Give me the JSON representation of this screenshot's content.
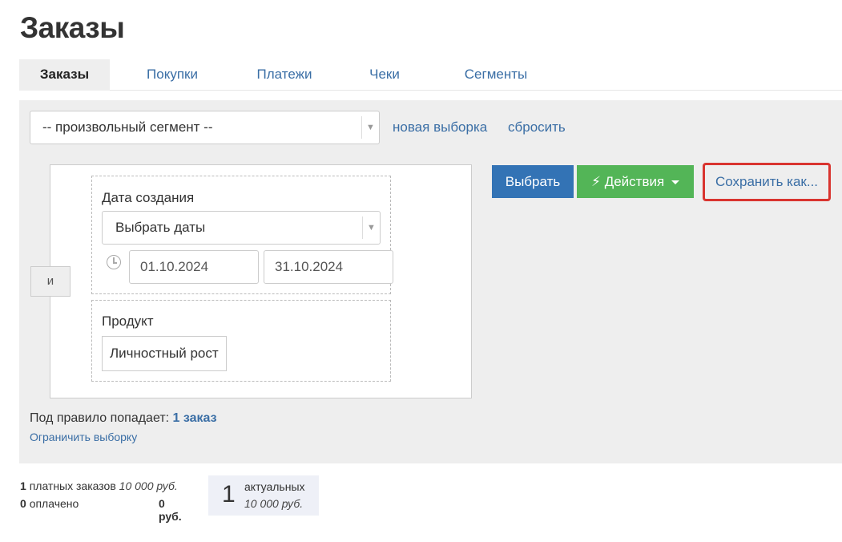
{
  "page": {
    "title": "Заказы"
  },
  "tabs": [
    {
      "label": "Заказы",
      "active": true
    },
    {
      "label": "Покупки",
      "active": false
    },
    {
      "label": "Платежи",
      "active": false
    },
    {
      "label": "Чеки",
      "active": false
    },
    {
      "label": "Сегменты",
      "active": false
    }
  ],
  "filter": {
    "segment_select": {
      "value": "-- произвольный сегмент --"
    },
    "new_selection_label": "новая выборка",
    "reset_label": "сбросить",
    "logic_operator": "и",
    "conditions": {
      "created_date": {
        "label": "Дата создания",
        "select_value": "Выбрать даты",
        "date_from": "01.10.2024",
        "date_to": "31.10.2024"
      },
      "product": {
        "label": "Продукт",
        "value": "Личностный рост"
      }
    },
    "buttons": {
      "select_label": "Выбрать",
      "actions_label": "Действия",
      "save_as_label": "Сохранить как..."
    },
    "summary": {
      "prefix": "Под правило попадает:",
      "count_link": "1 заказ",
      "restrict_label": "Ограничить выборку"
    }
  },
  "stats": {
    "paid": {
      "count": "1",
      "label": "платных заказов",
      "amount": "10 000 руб."
    },
    "payed": {
      "count": "0",
      "label": "оплачено",
      "amount": "0 руб."
    },
    "actual": {
      "count": "1",
      "label": "актуальных",
      "amount": "10 000 руб."
    }
  },
  "colors": {
    "primary": "#3373b5",
    "success": "#53b557",
    "highlight": "#d9342f",
    "link": "#3a6ea5",
    "panel": "#eeeeee"
  }
}
